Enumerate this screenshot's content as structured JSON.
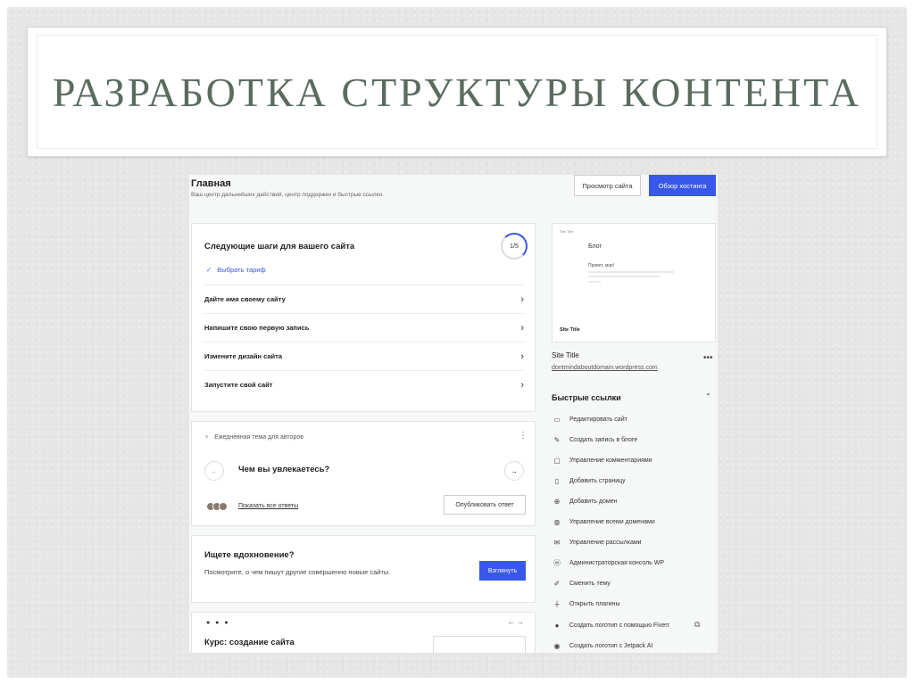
{
  "slide": {
    "title": "РАЗРАБОТКА СТРУКТУРЫ КОНТЕНТА"
  },
  "header": {
    "title": "Главная",
    "subtitle": "Ваш центр дальнейших действий, центр поддержки и быстрые ссылки.",
    "view_site": "Просмотр сайта",
    "hosting": "Обзор хостинга"
  },
  "steps": {
    "title": "Следующие шаги для вашего сайта",
    "progress": "1/5",
    "done_item": "Выбрать тариф",
    "items": [
      {
        "label": "Дайте имя своему сайту"
      },
      {
        "label": "Напишите свою первую запись"
      },
      {
        "label": "Измените дизайн сайта"
      },
      {
        "label": "Запустите свой сайт"
      }
    ]
  },
  "prompt": {
    "heading": "Ежедневная тема для авторов",
    "question": "Чем вы увлекаетесь?",
    "show_answers": "Показать все ответы",
    "publish": "Опубликовать ответ"
  },
  "inspiration": {
    "title": "Ищете вдохновение?",
    "text": "Посмотрите, о чем пишут другие совершенно новые сайты.",
    "button": "Взглянуть"
  },
  "course": {
    "title": "Курс: создание сайта"
  },
  "preview": {
    "top_label": "Site Title",
    "blog": "Блог",
    "hello": "Привет, мир!",
    "footer": "Site Title"
  },
  "site": {
    "title": "Site Title",
    "url": "dontmindaboutdomain.wordpress.com"
  },
  "quick_links": {
    "title": "Быстрые ссылки",
    "items": [
      {
        "label": "Редактировать сайт",
        "icon": "laptop-icon"
      },
      {
        "label": "Создать запись в блоге",
        "icon": "pencil-icon"
      },
      {
        "label": "Управление комментариями",
        "icon": "comment-icon"
      },
      {
        "label": "Добавить страницу",
        "icon": "page-icon"
      },
      {
        "label": "Добавить домен",
        "icon": "plus-circle-icon"
      },
      {
        "label": "Управление всеми доменами",
        "icon": "globe-icon"
      },
      {
        "label": "Управление рассылками",
        "icon": "mail-icon"
      },
      {
        "label": "Администраторская консоль WP",
        "icon": "wordpress-icon"
      },
      {
        "label": "Сменить тему",
        "icon": "brush-icon"
      },
      {
        "label": "Открыть плагины",
        "icon": "plug-icon"
      },
      {
        "label": "Создать логотип с помощью Fiverr",
        "icon": "fiverr-icon"
      },
      {
        "label": "Создать логотип с Jetpack AI",
        "icon": "jetpack-icon"
      }
    ]
  },
  "colors": {
    "accent": "#3858e9",
    "title": "#5a6b5f"
  }
}
